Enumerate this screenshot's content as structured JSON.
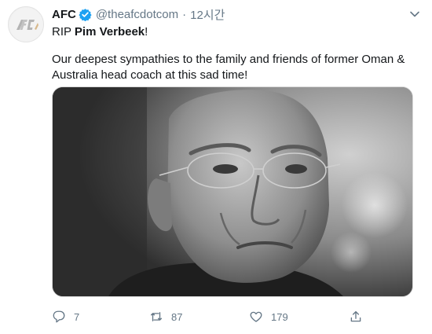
{
  "tweet": {
    "author_name": "AFC",
    "handle": "@theafcdotcom",
    "separator": "·",
    "time": "12시간",
    "text_prefix": "RIP ",
    "text_bold": "Pim Verbeek",
    "text_suffix": "!",
    "body": "Our deepest sympathies to the family and friends of former Oman & Australia head coach at this sad time!"
  },
  "actions": {
    "reply_count": "7",
    "retweet_count": "87",
    "like_count": "179"
  },
  "icons": {
    "avatar": "afc-logo",
    "verified": "verified-badge-icon",
    "menu": "chevron-down-icon",
    "reply": "reply-icon",
    "retweet": "retweet-icon",
    "like": "heart-icon",
    "share": "share-icon"
  },
  "colors": {
    "verified": "#1da1f2",
    "secondary_text": "#657786",
    "primary_text": "#14171a"
  }
}
